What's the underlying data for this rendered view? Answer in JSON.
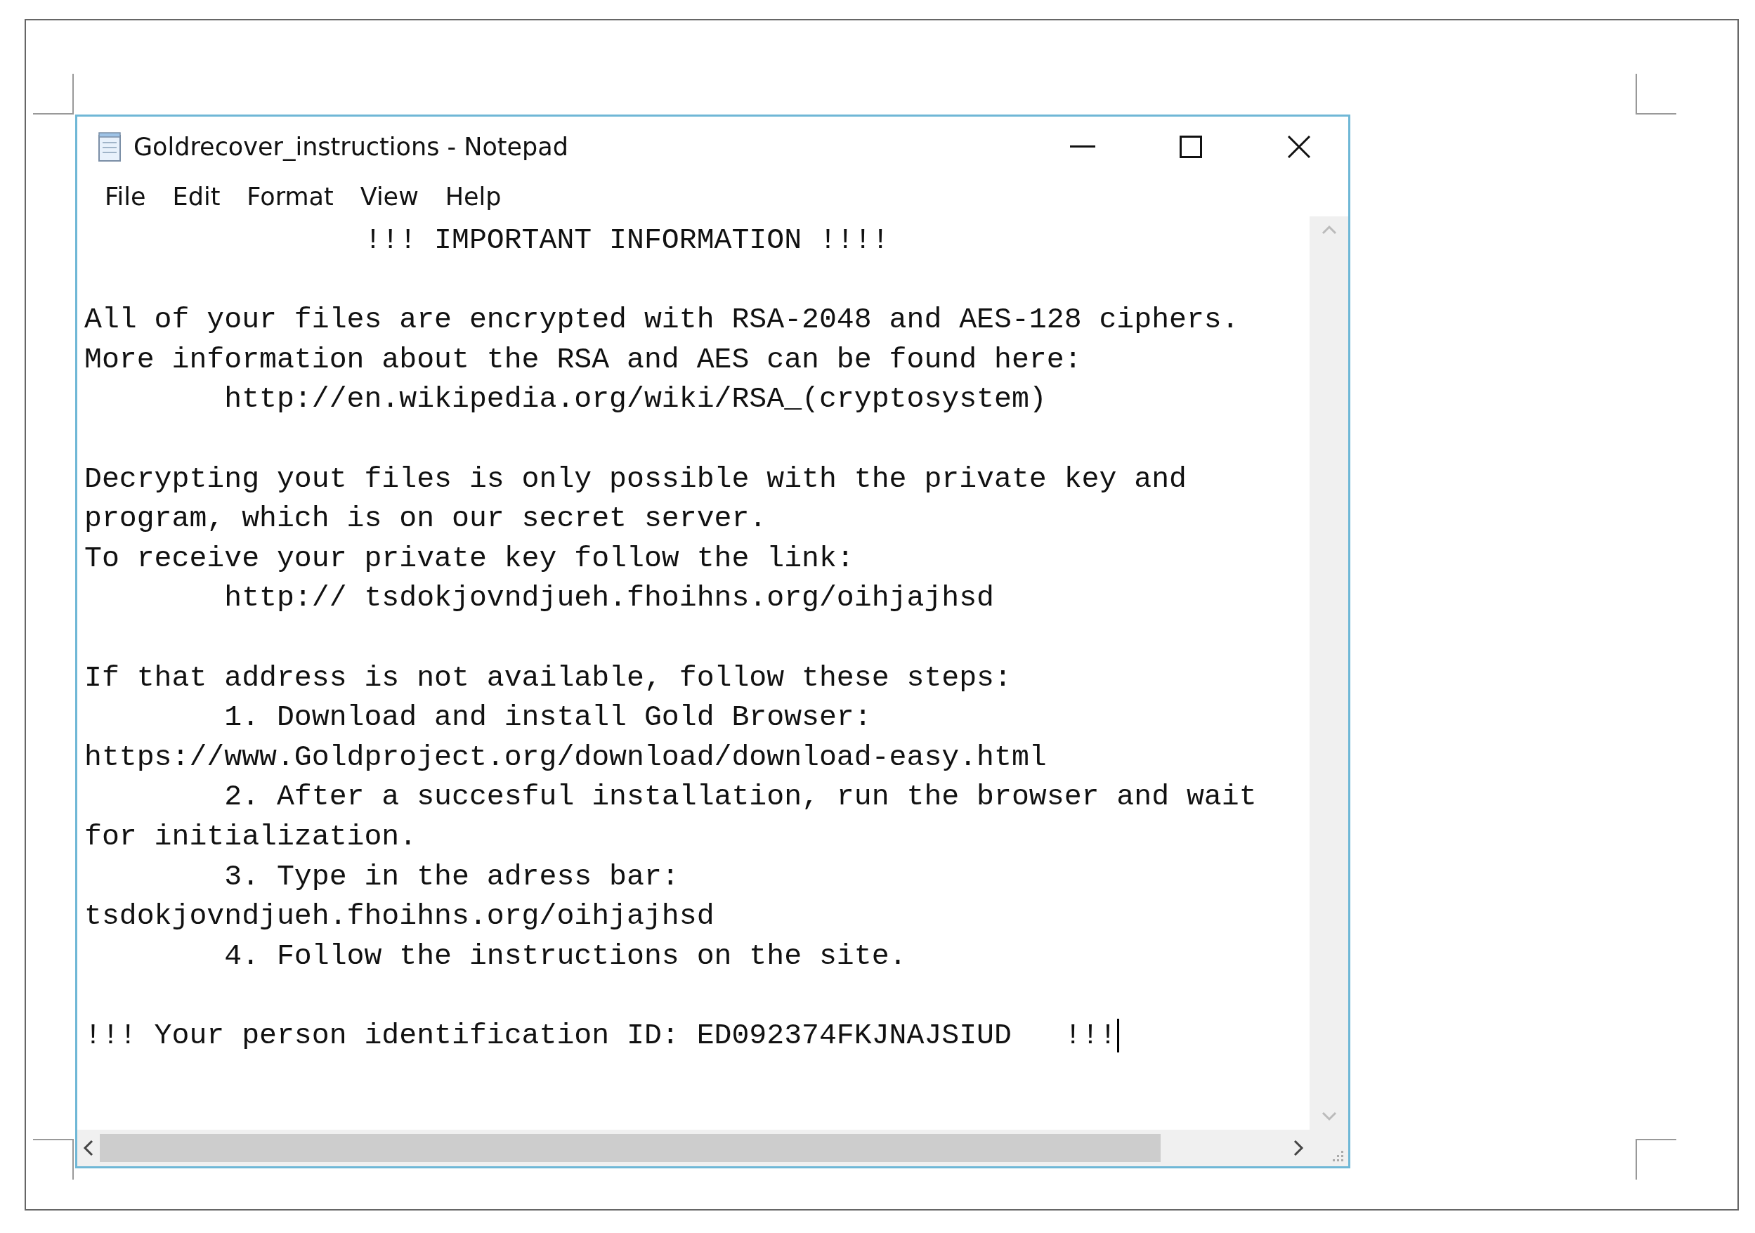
{
  "window": {
    "title": "Goldrecover_instructions - Notepad"
  },
  "menu": [
    "File",
    "Edit",
    "Format",
    "View",
    "Help"
  ],
  "document": {
    "paragraphs": [
      [
        "                !!! IMPORTANT INFORMATION !!!!"
      ],
      [
        "All of your files are encrypted with RSA-2048 and AES-128 ciphers.",
        "More information about the RSA and AES can be found here:",
        "        http://en.wikipedia.org/wiki/RSA_(cryptosystem)"
      ],
      [
        "Decrypting yout files is only possible with the private key and",
        "program, which is on our secret server.",
        "To receive your private key follow the link:",
        "        http:// tsdokjovndjueh.fhoihns.org/oihjajhsd"
      ],
      [
        "If that address is not available, follow these steps:",
        "        1. Download and install Gold Browser:",
        "https://www.Goldproject.org/download/download-easy.html",
        "        2. After a succesful installation, run the browser and wait",
        "for initialization.",
        "        3. Type in the adress bar:",
        "tsdokjovndjueh.fhoihns.org/oihjajhsd",
        "        4. Follow the instructions on the site."
      ],
      [
        "!!! Your person identification ID: ED092374FKJNAJSIUD   !!!"
      ]
    ]
  }
}
